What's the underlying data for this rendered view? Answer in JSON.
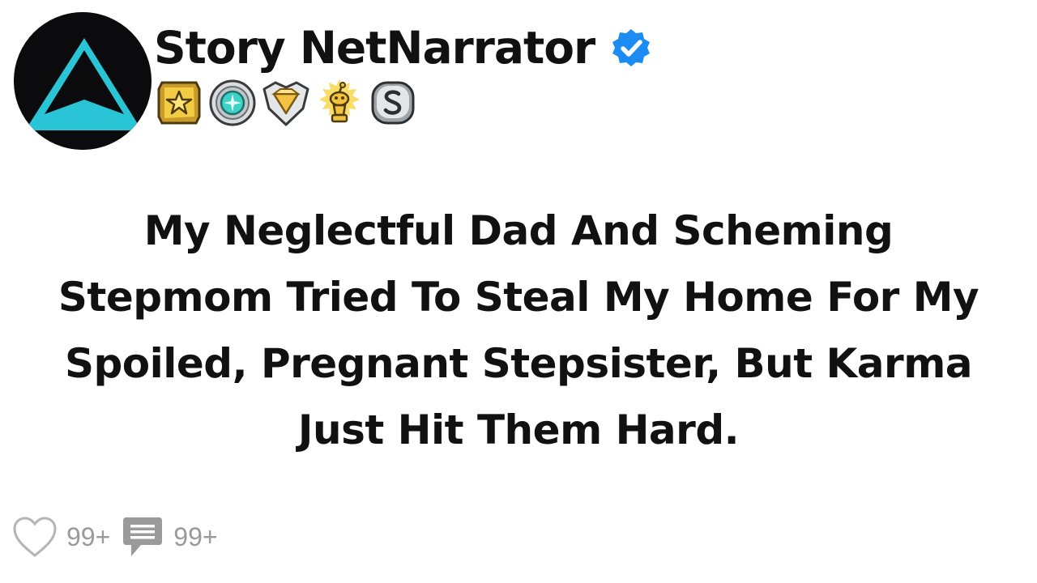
{
  "header": {
    "username": "Story NetNarrator",
    "verified_icon": "verified-check-icon",
    "avatar_icon": "triangle-logo-icon",
    "badges": [
      "star-medal-icon",
      "diamond-medal-icon",
      "gem-shield-icon",
      "trophy-alien-icon",
      "s-coin-icon"
    ]
  },
  "post": {
    "title": "My Neglectful Dad And Scheming Stepmom Tried To Steal My Home For My Spoiled, Pregnant Stepsister, But Karma Just Hit Them Hard."
  },
  "footer": {
    "likes_count": "99+",
    "comments_count": "99+",
    "like_icon": "heart-icon",
    "comment_icon": "comment-icon"
  },
  "colors": {
    "accent_teal": "#29c4d6",
    "verified_blue": "#1d8cf2",
    "muted_gray": "#9a9a9a"
  }
}
